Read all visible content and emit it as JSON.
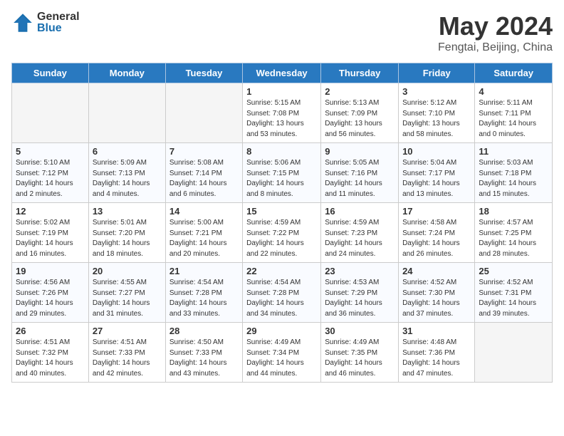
{
  "header": {
    "logo_general": "General",
    "logo_blue": "Blue",
    "title": "May 2024",
    "location": "Fengtai, Beijing, China"
  },
  "weekdays": [
    "Sunday",
    "Monday",
    "Tuesday",
    "Wednesday",
    "Thursday",
    "Friday",
    "Saturday"
  ],
  "weeks": [
    [
      {
        "day": "",
        "info": ""
      },
      {
        "day": "",
        "info": ""
      },
      {
        "day": "",
        "info": ""
      },
      {
        "day": "1",
        "info": "Sunrise: 5:15 AM\nSunset: 7:08 PM\nDaylight: 13 hours and 53 minutes."
      },
      {
        "day": "2",
        "info": "Sunrise: 5:13 AM\nSunset: 7:09 PM\nDaylight: 13 hours and 56 minutes."
      },
      {
        "day": "3",
        "info": "Sunrise: 5:12 AM\nSunset: 7:10 PM\nDaylight: 13 hours and 58 minutes."
      },
      {
        "day": "4",
        "info": "Sunrise: 5:11 AM\nSunset: 7:11 PM\nDaylight: 14 hours and 0 minutes."
      }
    ],
    [
      {
        "day": "5",
        "info": "Sunrise: 5:10 AM\nSunset: 7:12 PM\nDaylight: 14 hours and 2 minutes."
      },
      {
        "day": "6",
        "info": "Sunrise: 5:09 AM\nSunset: 7:13 PM\nDaylight: 14 hours and 4 minutes."
      },
      {
        "day": "7",
        "info": "Sunrise: 5:08 AM\nSunset: 7:14 PM\nDaylight: 14 hours and 6 minutes."
      },
      {
        "day": "8",
        "info": "Sunrise: 5:06 AM\nSunset: 7:15 PM\nDaylight: 14 hours and 8 minutes."
      },
      {
        "day": "9",
        "info": "Sunrise: 5:05 AM\nSunset: 7:16 PM\nDaylight: 14 hours and 11 minutes."
      },
      {
        "day": "10",
        "info": "Sunrise: 5:04 AM\nSunset: 7:17 PM\nDaylight: 14 hours and 13 minutes."
      },
      {
        "day": "11",
        "info": "Sunrise: 5:03 AM\nSunset: 7:18 PM\nDaylight: 14 hours and 15 minutes."
      }
    ],
    [
      {
        "day": "12",
        "info": "Sunrise: 5:02 AM\nSunset: 7:19 PM\nDaylight: 14 hours and 16 minutes."
      },
      {
        "day": "13",
        "info": "Sunrise: 5:01 AM\nSunset: 7:20 PM\nDaylight: 14 hours and 18 minutes."
      },
      {
        "day": "14",
        "info": "Sunrise: 5:00 AM\nSunset: 7:21 PM\nDaylight: 14 hours and 20 minutes."
      },
      {
        "day": "15",
        "info": "Sunrise: 4:59 AM\nSunset: 7:22 PM\nDaylight: 14 hours and 22 minutes."
      },
      {
        "day": "16",
        "info": "Sunrise: 4:59 AM\nSunset: 7:23 PM\nDaylight: 14 hours and 24 minutes."
      },
      {
        "day": "17",
        "info": "Sunrise: 4:58 AM\nSunset: 7:24 PM\nDaylight: 14 hours and 26 minutes."
      },
      {
        "day": "18",
        "info": "Sunrise: 4:57 AM\nSunset: 7:25 PM\nDaylight: 14 hours and 28 minutes."
      }
    ],
    [
      {
        "day": "19",
        "info": "Sunrise: 4:56 AM\nSunset: 7:26 PM\nDaylight: 14 hours and 29 minutes."
      },
      {
        "day": "20",
        "info": "Sunrise: 4:55 AM\nSunset: 7:27 PM\nDaylight: 14 hours and 31 minutes."
      },
      {
        "day": "21",
        "info": "Sunrise: 4:54 AM\nSunset: 7:28 PM\nDaylight: 14 hours and 33 minutes."
      },
      {
        "day": "22",
        "info": "Sunrise: 4:54 AM\nSunset: 7:28 PM\nDaylight: 14 hours and 34 minutes."
      },
      {
        "day": "23",
        "info": "Sunrise: 4:53 AM\nSunset: 7:29 PM\nDaylight: 14 hours and 36 minutes."
      },
      {
        "day": "24",
        "info": "Sunrise: 4:52 AM\nSunset: 7:30 PM\nDaylight: 14 hours and 37 minutes."
      },
      {
        "day": "25",
        "info": "Sunrise: 4:52 AM\nSunset: 7:31 PM\nDaylight: 14 hours and 39 minutes."
      }
    ],
    [
      {
        "day": "26",
        "info": "Sunrise: 4:51 AM\nSunset: 7:32 PM\nDaylight: 14 hours and 40 minutes."
      },
      {
        "day": "27",
        "info": "Sunrise: 4:51 AM\nSunset: 7:33 PM\nDaylight: 14 hours and 42 minutes."
      },
      {
        "day": "28",
        "info": "Sunrise: 4:50 AM\nSunset: 7:33 PM\nDaylight: 14 hours and 43 minutes."
      },
      {
        "day": "29",
        "info": "Sunrise: 4:49 AM\nSunset: 7:34 PM\nDaylight: 14 hours and 44 minutes."
      },
      {
        "day": "30",
        "info": "Sunrise: 4:49 AM\nSunset: 7:35 PM\nDaylight: 14 hours and 46 minutes."
      },
      {
        "day": "31",
        "info": "Sunrise: 4:48 AM\nSunset: 7:36 PM\nDaylight: 14 hours and 47 minutes."
      },
      {
        "day": "",
        "info": ""
      }
    ]
  ]
}
